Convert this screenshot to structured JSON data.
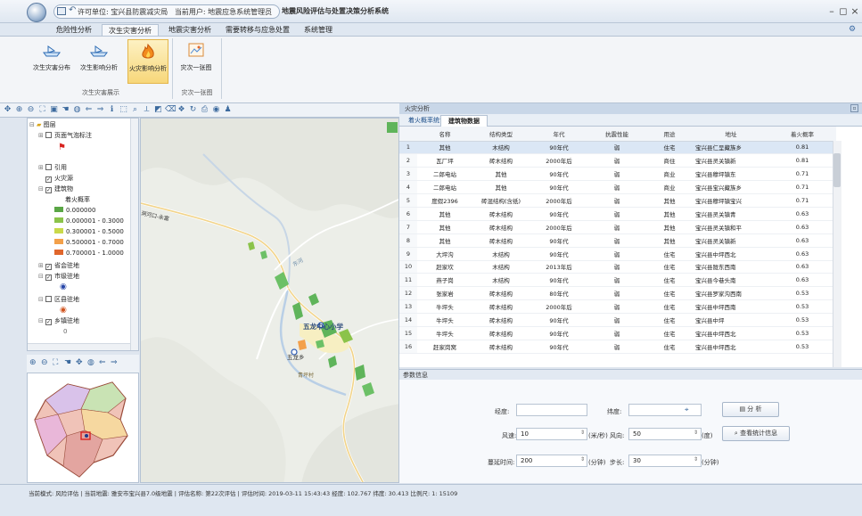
{
  "titlebar": {
    "permit_unit": "许可单位: 宝兴县防震减灾局",
    "current_user": "当前用户: 地震应急系统管理员",
    "app_title": "地震风险评估与处置决策分析系统",
    "min": "–",
    "restore": "◻",
    "close": "×"
  },
  "menu": {
    "tabs": [
      "危险性分析",
      "次生灾害分析",
      "地震灾害分析",
      "需要转移与应急处置",
      "系统管理"
    ],
    "active_index": 1
  },
  "ribbon": {
    "buttons": [
      {
        "label": "次生灾害分布",
        "icon": "flood-boat-icon"
      },
      {
        "label": "次生影响分析",
        "icon": "flood-boat-icon"
      },
      {
        "label": "火灾影响分析",
        "icon": "fire-icon"
      },
      {
        "label": "灾次一张图",
        "icon": "map-sheet-icon"
      }
    ],
    "active_index": 2,
    "group1_label": "次生灾害展示",
    "group2_label": "灾次一张图"
  },
  "layers": {
    "root": "图层",
    "items": [
      {
        "label": "页面气泡标注",
        "checked": false
      },
      {
        "label": "引用",
        "checked": false
      },
      {
        "label": "火灾源",
        "checked": true
      },
      {
        "label": "建筑物",
        "checked": true
      }
    ],
    "legend_title": "着火概率",
    "legend": [
      {
        "label": "0.000000",
        "color": "#5aa646"
      },
      {
        "label": "0.000001 - 0.3000",
        "color": "#8bc34a"
      },
      {
        "label": "0.300001 - 0.5000",
        "color": "#c9d94a"
      },
      {
        "label": "0.500001 - 0.7000",
        "color": "#f3a04a"
      },
      {
        "label": "0.700001 - 1.0000",
        "color": "#e0662c"
      }
    ],
    "items2": [
      {
        "label": "省会驻地",
        "checked": true
      },
      {
        "label": "市级驻地",
        "checked": true
      },
      {
        "label": "区县驻地",
        "checked": false
      },
      {
        "label": "乡镇驻地",
        "checked": true
      }
    ],
    "bottom_value": "0"
  },
  "map": {
    "label_school": "五龙中心小学",
    "label_town": "五龙乡",
    "label_road": "洞河口-永富",
    "label_village": "青坪村",
    "label_river": "东河"
  },
  "right_panel": {
    "title": "火灾分析",
    "tabs": [
      "着火概率统计",
      "建筑物数据"
    ],
    "active_tab": 1,
    "columns": [
      "名称",
      "结构类型",
      "年代",
      "抗震性能",
      "用途",
      "地址",
      "着火概率"
    ],
    "rows": [
      [
        "1",
        "其他",
        "木结构",
        "90年代",
        "弱",
        "住宅",
        "宝兴县仁呈藏族乡",
        "0.81"
      ],
      [
        "2",
        "瓦厂坪",
        "砖木结构",
        "2000年后",
        "弱",
        "商住",
        "宝兴县灵关镇新",
        "0.81"
      ],
      [
        "3",
        "二郎电站",
        "其他",
        "90年代",
        "弱",
        "商业",
        "宝兴县穆坪镇东",
        "0.71"
      ],
      [
        "4",
        "二郎电站",
        "其他",
        "90年代",
        "弱",
        "商业",
        "宝兴县宝兴藏族乡",
        "0.71"
      ],
      [
        "5",
        "度假2396",
        "砖混结构(含纸)",
        "2000年后",
        "弱",
        "其他",
        "宝兴县穆坪镇宝兴",
        "0.71"
      ],
      [
        "6",
        "其他",
        "砖木结构",
        "90年代",
        "弱",
        "其他",
        "宝兴县灵关镇青",
        "0.63"
      ],
      [
        "7",
        "其他",
        "砖木结构",
        "2000年后",
        "弱",
        "其他",
        "宝兴县灵关镇和平",
        "0.63"
      ],
      [
        "8",
        "其他",
        "砖木结构",
        "90年代",
        "弱",
        "其他",
        "宝兴县灵关镇新",
        "0.63"
      ],
      [
        "9",
        "大坪沟",
        "木结构",
        "90年代",
        "弱",
        "住宅",
        "宝兴县中坪西北",
        "0.63"
      ],
      [
        "10",
        "赶家坎",
        "木结构",
        "2013年后",
        "弱",
        "住宅",
        "宝兴县陇东西南",
        "0.63"
      ],
      [
        "11",
        "燕子岗",
        "木结构",
        "90年代",
        "弱",
        "住宅",
        "宝兴县今巷头南",
        "0.63"
      ],
      [
        "12",
        "张家岩",
        "砖木结构",
        "80年代",
        "弱",
        "住宅",
        "宝兴县罗家沟西南",
        "0.53"
      ],
      [
        "13",
        "牛坪头",
        "砖木结构",
        "2000年后",
        "弱",
        "住宅",
        "宝兴县中坪西南",
        "0.53"
      ],
      [
        "14",
        "牛坪头",
        "砖木结构",
        "90年代",
        "弱",
        "住宅",
        "宝兴县中坪",
        "0.53"
      ],
      [
        "15",
        "牛坪头",
        "砖木结构",
        "90年代",
        "弱",
        "住宅",
        "宝兴县中坪西北",
        "0.53"
      ],
      [
        "16",
        "赶家岗窝",
        "砖木结构",
        "90年代",
        "弱",
        "住宅",
        "宝兴县中坪西北",
        "0.53"
      ]
    ]
  },
  "params": {
    "header": "参数信息",
    "lon_label": "经度:",
    "lon_value": "",
    "lat_label": "纬度:",
    "lat_value": "",
    "analyze_btn": "分 析",
    "wind_speed_label": "风速:",
    "wind_speed_value": "10",
    "wind_speed_unit": "(米/秒)",
    "wind_dir_label": "风向:",
    "wind_dir_value": "50",
    "wind_dir_unit": "(度)",
    "stats_btn": "查看统计信息",
    "time_label": "蔓延时间:",
    "time_value": "200",
    "time_unit": "(分钟)",
    "step_label": "步长:",
    "step_value": "30",
    "step_unit": "(分钟)"
  },
  "status": {
    "text": "当前模式: 风险评估 | 当前地震: 雅安市宝兴县7.0级地震 | 评估名称: 第22次评估 | 评估时间: 2019-03-11 15:43:43   经度: 102.767   纬度: 30.413   比例尺: 1: 15109"
  }
}
